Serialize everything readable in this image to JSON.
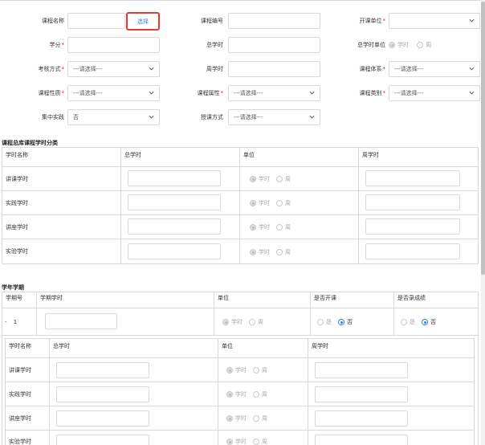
{
  "form": {
    "course_name_label": "课程名称",
    "select_button": "选择",
    "course_code_label": "课程编号",
    "offering_unit_label": "开课单位",
    "credit_label": "学分",
    "total_hours_label": "总学时",
    "total_hours_unit_label": "总学时单位",
    "unit_options": [
      "学时",
      "周"
    ],
    "assessment_label": "考核方式",
    "weekly_hours_label": "周学时",
    "course_system_label": "课程体系",
    "course_nature_label": "课程性质",
    "course_attribute_label": "课程属性",
    "course_category_label": "课程类别",
    "concentrated_label": "集中实践",
    "teaching_method_label": "授课方式",
    "placeholder_select": "---请选择---",
    "concentrated_value": "否"
  },
  "hours_table": {
    "title": "课程总库课程学时分类",
    "headers": [
      "学时名称",
      "总学时",
      "单位",
      "周学时"
    ],
    "rows": [
      "讲课学时",
      "实践学时",
      "讲座学时",
      "实验学时"
    ],
    "unit_options": [
      "学时",
      "周"
    ]
  },
  "term_table": {
    "title": "学年学期",
    "headers": [
      "学期号",
      "学期学时",
      "单位",
      "是否开课",
      "是否录成绩"
    ],
    "term_number": "1",
    "expand_symbol": "-",
    "unit_options": [
      "学时",
      "周"
    ],
    "yes_no": [
      "是",
      "否"
    ],
    "inner_headers": [
      "学时名称",
      "总学时",
      "单位",
      "周学时"
    ],
    "inner_rows": [
      "讲课学时",
      "实践学时",
      "讲座学时",
      "实验学时"
    ]
  },
  "colors": {
    "accent": "#3d7be8",
    "required": "#e02020",
    "highlight": "#e53935",
    "border": "#d9d9d9"
  },
  "icons": {
    "chevron": "chevron-down-icon"
  }
}
